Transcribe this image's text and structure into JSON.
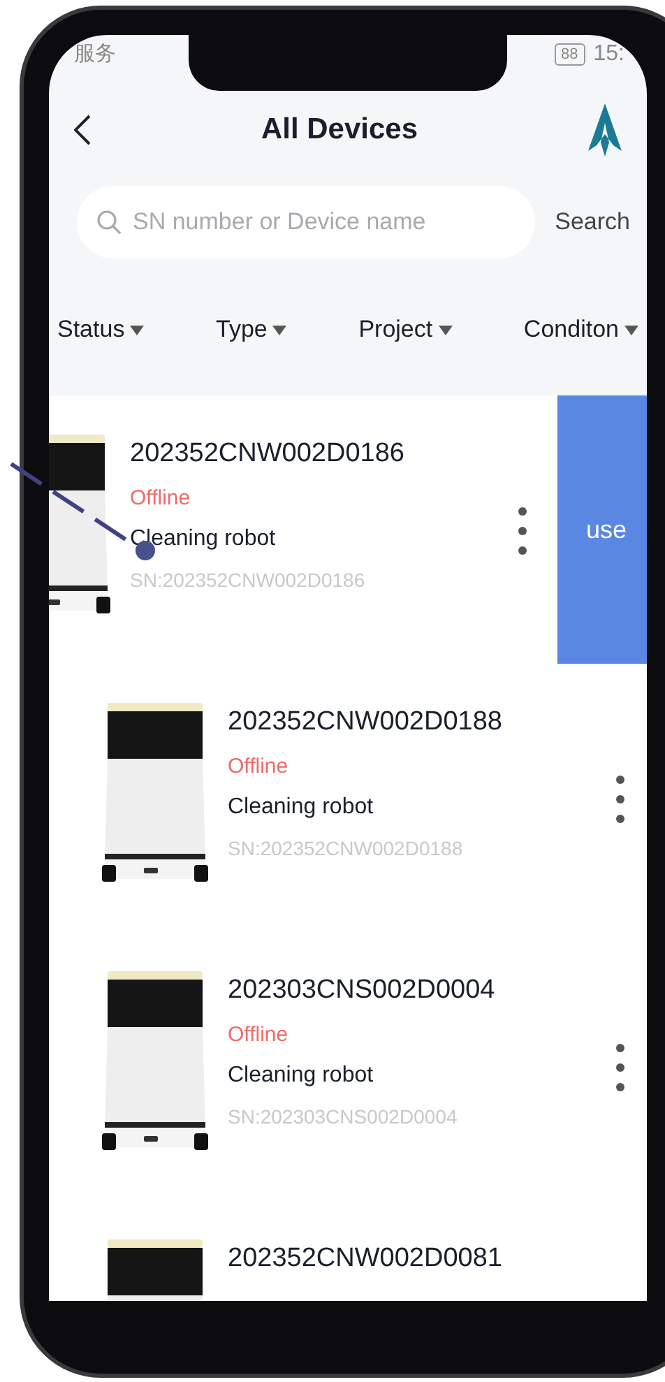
{
  "status_bar": {
    "left_text": "服务",
    "battery": "88",
    "time": "15:"
  },
  "header": {
    "title": "All Devices"
  },
  "search": {
    "placeholder": "SN number or Device name",
    "button": "Search"
  },
  "filters": [
    {
      "label": "Status"
    },
    {
      "label": "Type"
    },
    {
      "label": "Project"
    },
    {
      "label": "Conditon"
    }
  ],
  "devices": [
    {
      "name": "202352CNW002D0186",
      "status": "Offline",
      "type": "Cleaning robot",
      "sn": "SN:202352CNW002D0186",
      "swiped": true,
      "action": "use"
    },
    {
      "name": "202352CNW002D0188",
      "status": "Offline",
      "type": "Cleaning robot",
      "sn": "SN:202352CNW002D0188",
      "swiped": false
    },
    {
      "name": "202303CNS002D0004",
      "status": "Offline",
      "type": "Cleaning robot",
      "sn": "SN:202303CNS002D0004",
      "swiped": false
    },
    {
      "name": "202352CNW002D0081",
      "swiped": false
    }
  ]
}
